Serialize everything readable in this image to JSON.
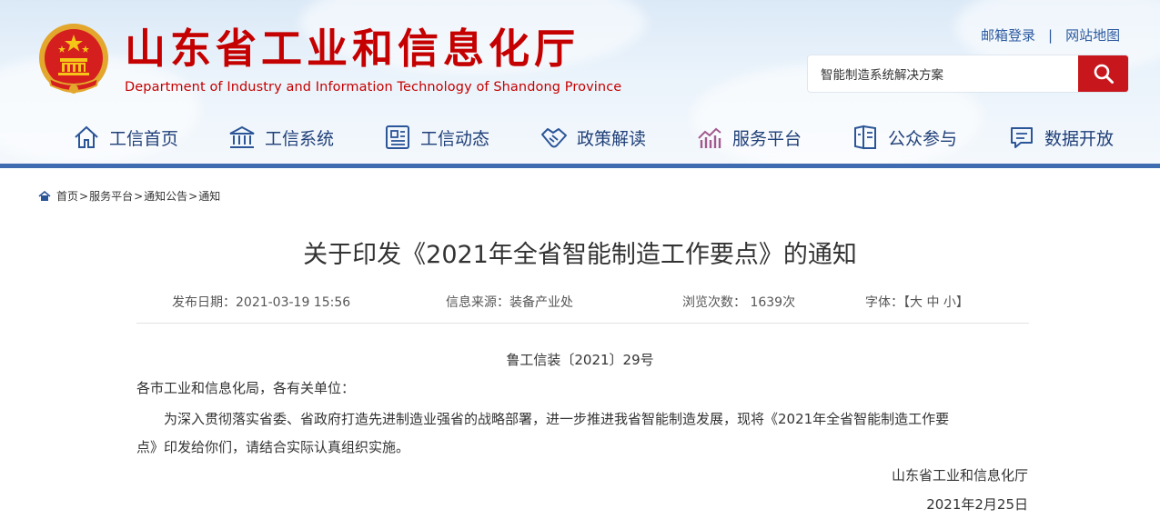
{
  "header": {
    "title_cn": "山东省工业和信息化厅",
    "title_en": "Department of Industry and Information Technology of Shandong Province",
    "mail_login": "邮箱登录",
    "separator": "|",
    "site_map": "网站地图",
    "search_value": "智能制造系统解决方案",
    "brand_red": "#c40000",
    "accent_blue": "#3f6bb0"
  },
  "nav": {
    "items": [
      {
        "label": "工信首页",
        "icon": "home-icon"
      },
      {
        "label": "工信系统",
        "icon": "building-icon"
      },
      {
        "label": "工信动态",
        "icon": "news-icon"
      },
      {
        "label": "政策解读",
        "icon": "handshake-icon"
      },
      {
        "label": "服务平台",
        "icon": "platform-icon"
      },
      {
        "label": "公众参与",
        "icon": "participation-icon"
      },
      {
        "label": "数据开放",
        "icon": "data-chat-icon"
      }
    ]
  },
  "breadcrumb": {
    "items": [
      "首页",
      "服务平台",
      "通知公告",
      "通知"
    ],
    "sep": ">"
  },
  "article": {
    "title": "关于印发《2021年全省智能制造工作要点》的通知",
    "publish_date": "发布日期：2021-03-19 15:56",
    "source": "信息来源：装备产业处",
    "views": "浏览次数： 1639次",
    "font_label": "字体：【",
    "font_large": "大",
    "font_medium": "中",
    "font_small": "小",
    "font_end": "】",
    "doc_number": "鲁工信装〔2021〕29号",
    "salutation": "各市工业和信息化局，各有关单位：",
    "body_line1": "为深入贯彻落实省委、省政府打造先进制造业强省的战略部署，进一步推进我省智能制造发展，现将《2021年全省智能制造工作要",
    "body_line2": "点》印发给你们，请结合实际认真组织实施。",
    "signature": "山东省工业和信息化厅",
    "sign_date": "2021年2月25日"
  }
}
